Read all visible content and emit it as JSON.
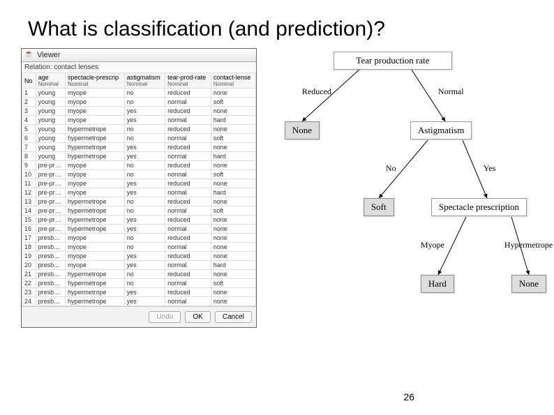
{
  "title": "What is classification (and prediction)?",
  "page_number": "26",
  "viewer": {
    "window_title": "Viewer",
    "relation_label": "Relation: contact lenses",
    "buttons": {
      "undo": "Undo",
      "ok": "OK",
      "cancel": "Cancel"
    },
    "columns": [
      {
        "name": "No",
        "type": ""
      },
      {
        "name": "age",
        "type": "Nominal"
      },
      {
        "name": "spectacle-prescrip",
        "type": "Nominal"
      },
      {
        "name": "astigmatism",
        "type": "Nominal"
      },
      {
        "name": "tear-prod-rate",
        "type": "Nominal"
      },
      {
        "name": "contact-lense",
        "type": "Nominal"
      }
    ],
    "rows": [
      [
        "1",
        "young",
        "myope",
        "no",
        "reduced",
        "none"
      ],
      [
        "2",
        "young",
        "myope",
        "no",
        "normal",
        "soft"
      ],
      [
        "3",
        "young",
        "myope",
        "yes",
        "reduced",
        "none"
      ],
      [
        "4",
        "young",
        "myope",
        "yes",
        "normal",
        "hard"
      ],
      [
        "5",
        "young",
        "hypermetrope",
        "no",
        "reduced",
        "none"
      ],
      [
        "6",
        "young",
        "hypermetrope",
        "no",
        "normal",
        "soft"
      ],
      [
        "7",
        "young",
        "hypermetrope",
        "yes",
        "reduced",
        "none"
      ],
      [
        "8",
        "young",
        "hypermetrope",
        "yes",
        "normal",
        "hard"
      ],
      [
        "9",
        "pre-pr…",
        "myope",
        "no",
        "reduced",
        "none"
      ],
      [
        "10",
        "pre-pr…",
        "myope",
        "no",
        "normal",
        "soft"
      ],
      [
        "11",
        "pre-pr…",
        "myope",
        "yes",
        "reduced",
        "none"
      ],
      [
        "12",
        "pre-pr…",
        "myope",
        "yes",
        "normal",
        "hard"
      ],
      [
        "13",
        "pre-pr…",
        "hypermetrope",
        "no",
        "reduced",
        "none"
      ],
      [
        "14",
        "pre-pr…",
        "hypermetrope",
        "no",
        "normal",
        "soft"
      ],
      [
        "15",
        "pre-pr…",
        "hypermetrope",
        "yes",
        "reduced",
        "none"
      ],
      [
        "16",
        "pre-pr…",
        "hypermetrope",
        "yes",
        "normal",
        "none"
      ],
      [
        "17",
        "presb…",
        "myope",
        "no",
        "reduced",
        "none"
      ],
      [
        "18",
        "presb…",
        "myope",
        "no",
        "normal",
        "none"
      ],
      [
        "19",
        "presb…",
        "myope",
        "yes",
        "reduced",
        "none"
      ],
      [
        "20",
        "presb…",
        "myope",
        "yes",
        "normal",
        "hard"
      ],
      [
        "21",
        "presb…",
        "hypermetrope",
        "no",
        "reduced",
        "none"
      ],
      [
        "22",
        "presb…",
        "hypermetrope",
        "no",
        "normal",
        "soft"
      ],
      [
        "23",
        "presb…",
        "hypermetrope",
        "yes",
        "reduced",
        "none"
      ],
      [
        "24",
        "presb…",
        "hypermetrope",
        "yes",
        "normal",
        "none"
      ]
    ]
  },
  "tree": {
    "root": "Tear production rate",
    "root_left_label": "Reduced",
    "root_right_label": "Normal",
    "none1": "None",
    "astigmatism": "Astigmatism",
    "astig_left_label": "No",
    "astig_right_label": "Yes",
    "soft": "Soft",
    "spectacle": "Spectacle prescription",
    "spec_left_label": "Myope",
    "spec_right_label": "Hypermetrope",
    "hard": "Hard",
    "none2": "None"
  }
}
